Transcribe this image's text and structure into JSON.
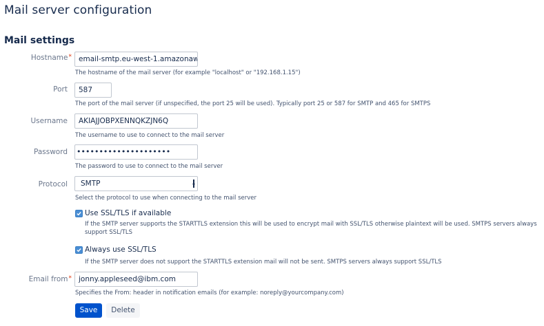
{
  "page": {
    "title": "Mail server configuration"
  },
  "section": {
    "title": "Mail settings"
  },
  "required_marker": "*",
  "fields": {
    "hostname": {
      "label": "Hostname",
      "value": "email-smtp.eu-west-1.amazonaws",
      "help": "The hostname of the mail server (for example \"localhost\" or \"192.168.1.15\")"
    },
    "port": {
      "label": "Port",
      "value": "587",
      "help": "The port of the mail server (if unspecified, the port 25 will be used). Typically port 25 or 587 for SMTP and 465 for SMTPS"
    },
    "username": {
      "label": "Username",
      "value": "AKIAJJOBPXENNQKZJN6Q",
      "help": "The username to use to connect to the mail server"
    },
    "password": {
      "label": "Password",
      "masked_value": "•••••••••••••••••••••",
      "help": "The password to use to connect to the mail server"
    },
    "protocol": {
      "label": "Protocol",
      "value": "SMTP",
      "help": "Select the protocol to use when connecting to the mail server"
    },
    "use_ssl": {
      "label": "Use SSL/TLS if available",
      "checked": true,
      "help": "If the SMTP server supports the STARTTLS extension this will be used to encrypt mail with SSL/TLS otherwise plaintext will be used. SMTPS servers always support SSL/TLS"
    },
    "always_ssl": {
      "label": "Always use SSL/TLS",
      "checked": true,
      "help": "If the SMTP server does not support the STARTTLS extension mail will not be sent. SMTPS servers always support SSL/TLS"
    },
    "email_from": {
      "label": "Email from",
      "value": "jonny.appleseed@ibm.com",
      "help": "Specifies the From: header in notification emails (for example: noreply@yourcompany.com)"
    }
  },
  "buttons": {
    "save": "Save",
    "delete": "Delete"
  },
  "colors": {
    "primary": "#0052cc",
    "checkbox": "#4a8ed4",
    "required": "#de350b"
  }
}
